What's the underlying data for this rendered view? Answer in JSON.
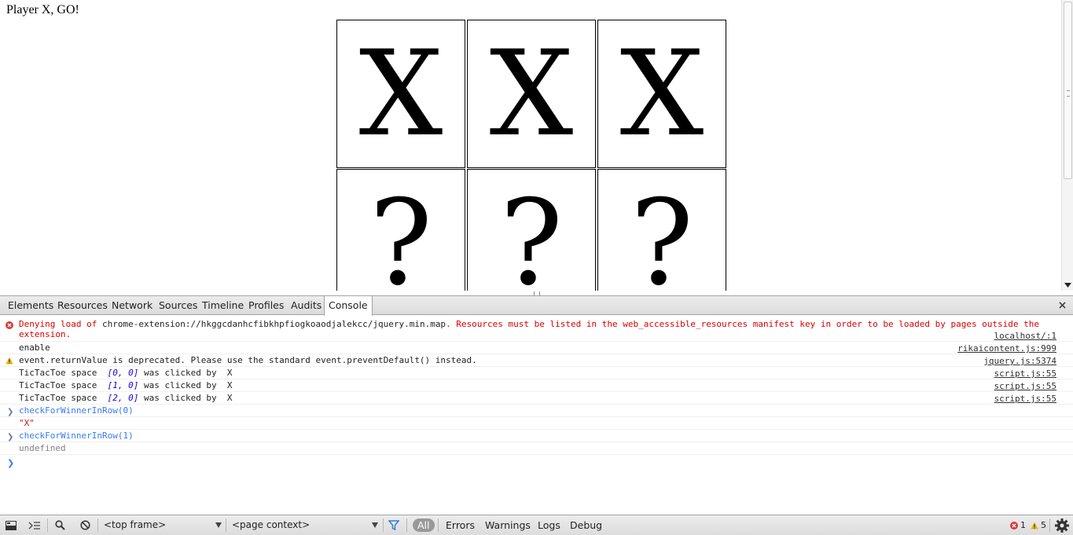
{
  "page": {
    "status": "Player X, GO!",
    "board": [
      "X",
      "X",
      "X",
      "?",
      "?",
      "?"
    ]
  },
  "devtools": {
    "tabs": [
      "Elements",
      "Resources",
      "Network",
      "Sources",
      "Timeline",
      "Profiles",
      "Audits",
      "Console"
    ],
    "active_tab": "Console",
    "close_icon": "close-icon",
    "console": {
      "error": {
        "prefix": "Denying load of ",
        "url": "chrome-extension://hkggcdanhcfibkhpfiogkoaodjalekcc/jquery.min.map",
        "suffix": ". Resources must be listed in the web_accessible_resources manifest key in order to be loaded by pages outside the extension.",
        "source": "localhost/:1"
      },
      "enable": {
        "text": "enable",
        "source": "rikaicontent.js:999"
      },
      "warning": {
        "text": "event.returnValue is deprecated. Please use the standard event.preventDefault() instead.",
        "source": "jquery.js:5374"
      },
      "clicks": [
        {
          "pre": "TicTacToe space  ",
          "coord": "[0, 0]",
          "post": " was clicked by  X",
          "source": "script.js:55"
        },
        {
          "pre": "TicTacToe space  ",
          "coord": "[1, 0]",
          "post": " was clicked by  X",
          "source": "script.js:55"
        },
        {
          "pre": "TicTacToe space  ",
          "coord": "[2, 0]",
          "post": " was clicked by  X",
          "source": "script.js:55"
        }
      ],
      "command1": "checkForWinnerInRow(0)",
      "result1": "\"X\"",
      "command2": "checkForWinnerInRow(1)",
      "result2": "undefined",
      "prompt": ">"
    },
    "statusbar": {
      "frame": "<top frame>",
      "context": "<page context>",
      "filters": [
        "All",
        "Errors",
        "Warnings",
        "Logs",
        "Debug"
      ],
      "active_filter": "All",
      "error_count": "1",
      "warning_count": "5"
    },
    "colors": {
      "error": "#dd0000",
      "warning": "#f0b400",
      "command": "#367cf1",
      "string": "#c41a16"
    }
  }
}
